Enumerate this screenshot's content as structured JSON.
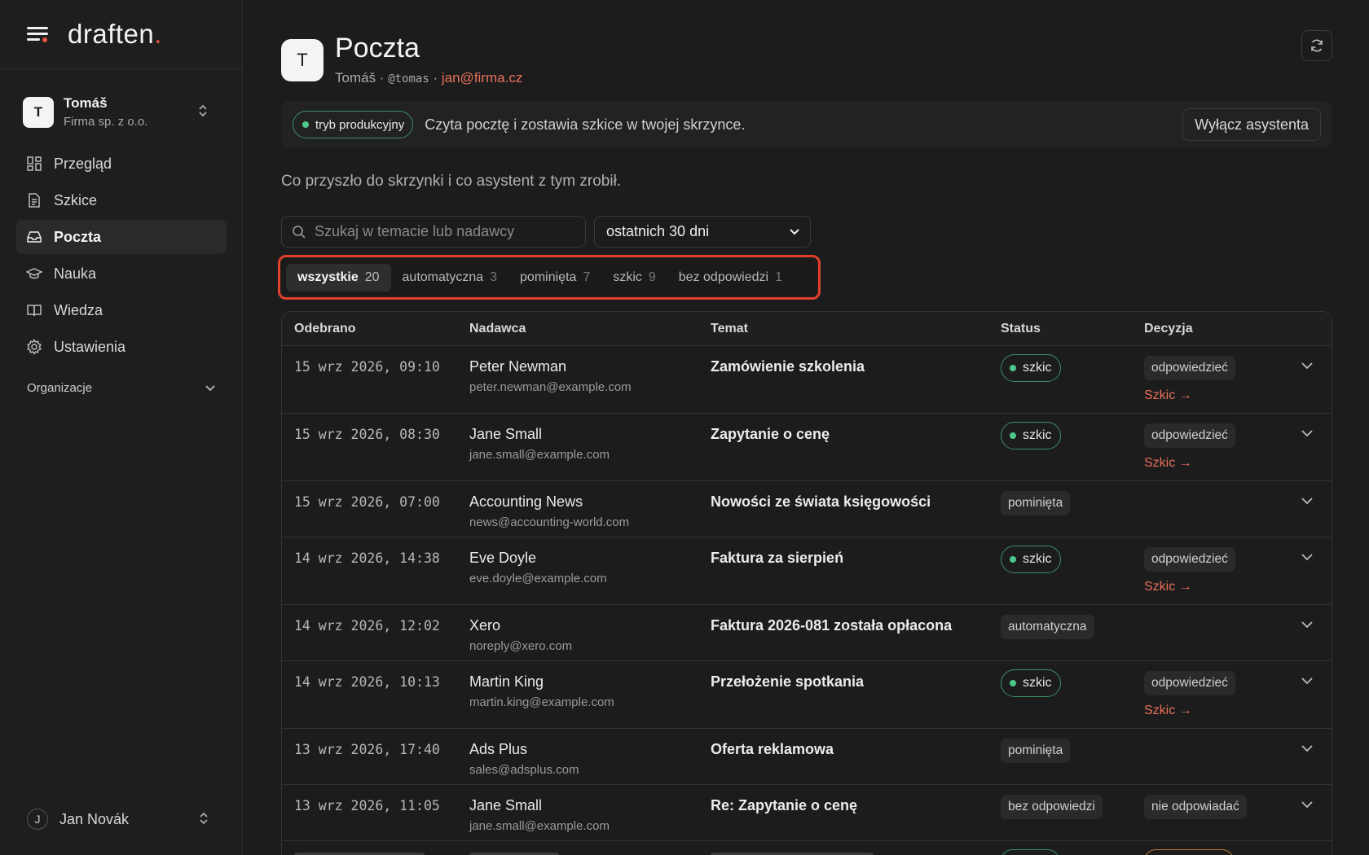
{
  "brand": {
    "name": "draften",
    "dot": "."
  },
  "workspace": {
    "initial": "T",
    "name": "Tomáš",
    "company": "Firma sp. z o.o."
  },
  "nav": [
    {
      "label": "Przegląd",
      "icon": "grid-icon"
    },
    {
      "label": "Szkice",
      "icon": "document-icon"
    },
    {
      "label": "Poczta",
      "icon": "inbox-icon",
      "active": true
    },
    {
      "label": "Nauka",
      "icon": "graduation-cap-icon"
    },
    {
      "label": "Wiedza",
      "icon": "book-icon"
    },
    {
      "label": "Ustawienia",
      "icon": "gear-icon"
    }
  ],
  "org_label": "Organizacje",
  "user": {
    "initial": "J",
    "name": "Jan Novák"
  },
  "header": {
    "initial": "T",
    "title": "Poczta",
    "name": "Tomáš",
    "sep1": " · ",
    "handle": "@tomas",
    "sep2": " · ",
    "email": "jan@firma.cz"
  },
  "banner": {
    "mode": "tryb produkcyjny",
    "text": "Czyta pocztę i zostawia szkice w twojej skrzynce.",
    "button": "Wyłącz asystenta"
  },
  "lead": "Co przyszło do skrzynki i co asystent z tym zrobił.",
  "search": {
    "placeholder": "Szukaj w temacie lub nadawcy"
  },
  "period": {
    "value": "ostatnich 30 dni"
  },
  "tabs": [
    {
      "label": "wszystkie",
      "count": "20",
      "active": true
    },
    {
      "label": "automatyczna",
      "count": "3"
    },
    {
      "label": "pominięta",
      "count": "7"
    },
    {
      "label": "szkic",
      "count": "9"
    },
    {
      "label": "bez odpowiedzi",
      "count": "1"
    }
  ],
  "columns": {
    "received": "Odebrano",
    "sender": "Nadawca",
    "subject": "Temat",
    "status": "Status",
    "decision": "Decyzja"
  },
  "rows": [
    {
      "date": "15 wrz 2026, 09:10",
      "name": "Peter Newman",
      "email": "peter.newman@example.com",
      "subject": "Zamówienie szkolenia",
      "status": "szkic",
      "decision": "odpowiedzieć",
      "link": "Szkic →"
    },
    {
      "date": "15 wrz 2026, 08:30",
      "name": "Jane Small",
      "email": "jane.small@example.com",
      "subject": "Zapytanie o cenę",
      "status": "szkic",
      "decision": "odpowiedzieć",
      "link": "Szkic →"
    },
    {
      "date": "15 wrz 2026, 07:00",
      "name": "Accounting News",
      "email": "news@accounting-world.com",
      "subject": "Nowości ze świata księgowości",
      "status": "pominięta"
    },
    {
      "date": "14 wrz 2026, 14:38",
      "name": "Eve Doyle",
      "email": "eve.doyle@example.com",
      "subject": "Faktura za sierpień",
      "status": "szkic",
      "decision": "odpowiedzieć",
      "link": "Szkic →"
    },
    {
      "date": "14 wrz 2026, 12:02",
      "name": "Xero",
      "email": "noreply@xero.com",
      "subject": "Faktura 2026-081 została opłacona",
      "status": "automatyczna"
    },
    {
      "date": "14 wrz 2026, 10:13",
      "name": "Martin King",
      "email": "martin.king@example.com",
      "subject": "Przełożenie spotkania",
      "status": "szkic",
      "decision": "odpowiedzieć",
      "link": "Szkic →"
    },
    {
      "date": "13 wrz 2026, 17:40",
      "name": "Ads Plus",
      "email": "sales@adsplus.com",
      "subject": "Oferta reklamowa",
      "status": "pominięta"
    },
    {
      "date": "13 wrz 2026, 11:05",
      "name": "Jane Small",
      "email": "jane.small@example.com",
      "subject": "Re: Zapytanie o cenę",
      "status": "bez odpowiedzi",
      "decision": "nie odpowiadać"
    }
  ],
  "colors": {
    "accent": "#e8705a",
    "brand_dot": "#e8563f",
    "status_green": "#4ec88a",
    "highlight": "#e0402c"
  }
}
